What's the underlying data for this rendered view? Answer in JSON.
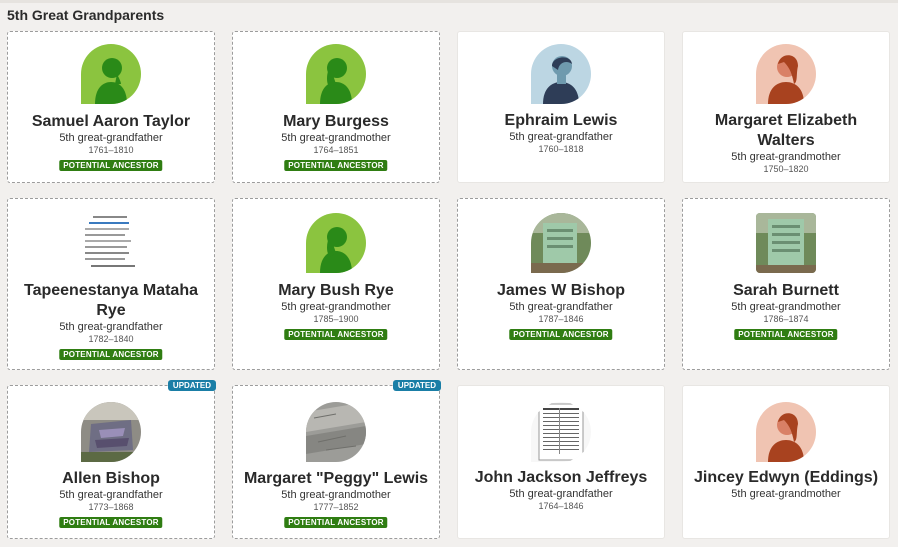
{
  "section": {
    "title": "5th Great Grandparents"
  },
  "labels": {
    "potential": "POTENTIAL ANCESTOR",
    "updated": "UPDATED"
  },
  "cards": [
    {
      "name": "Samuel Aaron Taylor",
      "relation": "5th great-grandfather",
      "years": "1761–1810",
      "potential": true,
      "updated": false,
      "avatar": "silhouette-green"
    },
    {
      "name": "Mary Burgess",
      "relation": "5th great-grandmother",
      "years": "1764–1851",
      "potential": true,
      "updated": false,
      "avatar": "silhouette-green"
    },
    {
      "name": "Ephraim Lewis",
      "relation": "5th great-grandfather",
      "years": "1760–1818",
      "potential": false,
      "updated": false,
      "avatar": "silhouette-blue-male"
    },
    {
      "name": "Margaret Elizabeth Walters",
      "relation": "5th great-grandmother",
      "years": "1750–1820",
      "potential": false,
      "updated": false,
      "avatar": "silhouette-peach-female"
    },
    {
      "name": "Tapeenestanya Mataha Rye",
      "relation": "5th great-grandfather",
      "years": "1782–1840",
      "potential": true,
      "updated": false,
      "avatar": "document-photo"
    },
    {
      "name": "Mary Bush Rye",
      "relation": "5th great-grandmother",
      "years": "1785–1900",
      "potential": true,
      "updated": false,
      "avatar": "silhouette-green"
    },
    {
      "name": "James W Bishop",
      "relation": "5th great-grandfather",
      "years": "1787–1846",
      "potential": true,
      "updated": false,
      "avatar": "gravestone-photo"
    },
    {
      "name": "Sarah Burnett",
      "relation": "5th great-grandmother",
      "years": "1786–1874",
      "potential": true,
      "updated": false,
      "avatar": "gravestone-photo"
    },
    {
      "name": "Allen Bishop",
      "relation": "5th great-grandfather",
      "years": "1773–1868",
      "potential": true,
      "updated": true,
      "avatar": "stone-photo"
    },
    {
      "name": "Margaret \"Peggy\" Lewis",
      "relation": "5th great-grandmother",
      "years": "1777–1852",
      "potential": true,
      "updated": true,
      "avatar": "stone-photo-gray"
    },
    {
      "name": "John Jackson Jeffreys",
      "relation": "5th great-grandfather",
      "years": "1764–1846",
      "potential": false,
      "updated": false,
      "avatar": "record-photo"
    },
    {
      "name": "Jincey Edwyn (Eddings)",
      "relation": "5th great-grandmother",
      "years": "",
      "potential": false,
      "updated": false,
      "avatar": "silhouette-peach-female"
    }
  ]
}
